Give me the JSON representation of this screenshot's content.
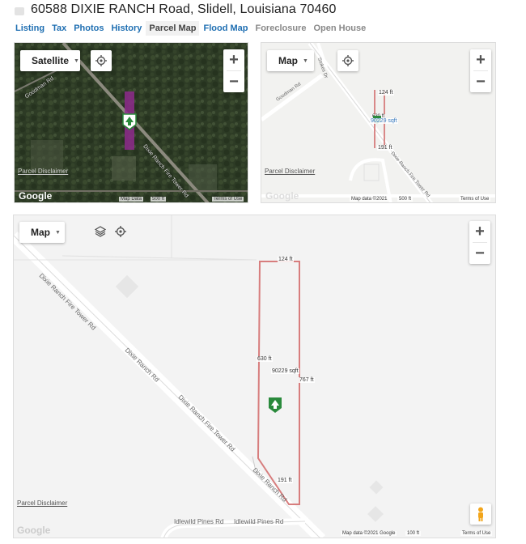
{
  "header": {
    "address": "60588 DIXIE RANCH Road, Slidell, Louisiana 70460"
  },
  "tabs": [
    {
      "label": "Listing"
    },
    {
      "label": "Tax"
    },
    {
      "label": "Photos"
    },
    {
      "label": "History"
    },
    {
      "label": "Parcel Map"
    },
    {
      "label": "Flood Map"
    },
    {
      "label": "Foreclosure"
    },
    {
      "label": "Open House"
    }
  ],
  "map_satellite": {
    "type_label": "Satellite",
    "disclaimer": "Parcel Disclaimer",
    "google": "Google",
    "attrib_data": "Map Data",
    "scale": "500 ft",
    "terms": "Terms of Use",
    "roads": {
      "goodman": "Goodman Rd",
      "dixie": "Dixie Ranch Fire Tower Rd"
    }
  },
  "map_small": {
    "type_label": "Map",
    "disclaimer": "Parcel Disclaimer",
    "google": "Google",
    "attrib_data": "Map data ©2021",
    "scale": "500 ft",
    "terms": "Terms of Use",
    "dims": {
      "top": "124 ft",
      "area": "90229 sqft",
      "bottom": "191 ft",
      "left": "630 ft"
    },
    "roads": {
      "goodman": "Goodman Rd",
      "stokes": "Stokes Dr",
      "dixie": "Dixie Ranch Fire Tower Rd"
    }
  },
  "map_large": {
    "type_label": "Map",
    "disclaimer": "Parcel Disclaimer",
    "google": "Google",
    "attrib_data": "Map data ©2021 Google",
    "scale": "100 ft",
    "terms": "Terms of Use",
    "dims": {
      "top": "124 ft",
      "left": "630 ft",
      "area": "90229 sqft",
      "right": "767 ft",
      "bottom": "191 ft"
    },
    "roads": {
      "dixie_fire_1": "Dixie Ranch Fire Tower Rd",
      "dixie_1": "Dixie Ranch Rd",
      "dixie_fire_2": "Dixie Ranch Fire Tower Rd",
      "dixie_2": "Dixie Ranch Rd",
      "idlewild_1": "Idlewild Pines Rd",
      "idlewild_2": "Idlewild Pines Rd"
    }
  }
}
